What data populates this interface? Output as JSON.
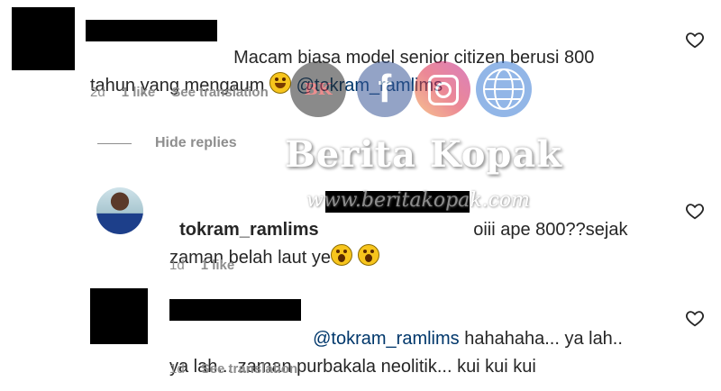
{
  "comments": [
    {
      "text": "Macam biasa model senior citizen berusi 800\ntahun yang mengaum ",
      "mention": "@tokram_ramlims",
      "time": "2d",
      "likes": "1 like",
      "action": "See translation"
    }
  ],
  "hide_replies_label": "Hide replies",
  "replies": [
    {
      "username": "tokram_ramlims",
      "text_line1": " oiii ape 800??sejak",
      "text_line2": "zaman belah laut ye",
      "time": "1d",
      "likes": "1 like"
    },
    {
      "mention": "@tokram_ramlims",
      "text_line1": " hahahaha... ya lah..",
      "text_line2": "ya lah... zaman purbakala neolitik... kui kui kui",
      "time": "1d",
      "action": "See translation"
    }
  ],
  "watermark": {
    "title": "Berita Kopak",
    "url": "www.beritakopak.com",
    "badge": "BK",
    "colors": {
      "bk": "#2b2b2b",
      "facebook": "#3b5998",
      "instagram": "#d6249f",
      "web": "#3a7bd5"
    }
  },
  "icons": [
    "heart-icon",
    "laugh-emoji",
    "surprised-emoji"
  ]
}
